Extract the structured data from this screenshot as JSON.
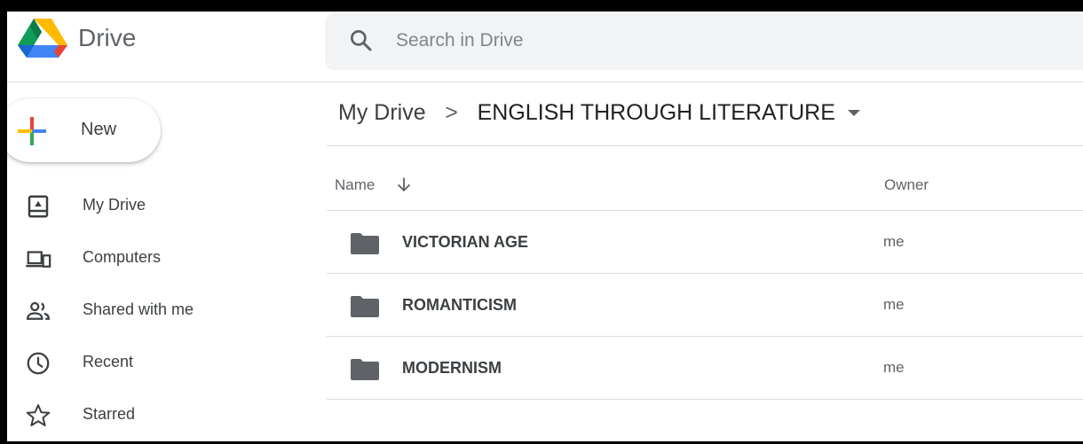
{
  "app": {
    "name": "Drive"
  },
  "search": {
    "placeholder": "Search in Drive"
  },
  "new_button": {
    "label": "New"
  },
  "sidebar": {
    "items": [
      {
        "label": "My Drive",
        "icon": "my-drive-icon"
      },
      {
        "label": "Computers",
        "icon": "computers-icon"
      },
      {
        "label": "Shared with me",
        "icon": "shared-icon"
      },
      {
        "label": "Recent",
        "icon": "clock-icon"
      },
      {
        "label": "Starred",
        "icon": "star-icon"
      }
    ]
  },
  "breadcrumb": {
    "root": "My Drive",
    "separator": ">",
    "current": "ENGLISH THROUGH LITERATURE"
  },
  "table": {
    "columns": {
      "name": "Name",
      "owner": "Owner"
    },
    "rows": [
      {
        "name": "VICTORIAN AGE",
        "owner": "me"
      },
      {
        "name": "ROMANTICISM",
        "owner": "me"
      },
      {
        "name": "MODERNISM",
        "owner": "me"
      }
    ]
  },
  "colors": {
    "folder": "#5f6368",
    "search_bg": "#f1f3f4",
    "divider": "#dadce0",
    "text": "#3c4043"
  }
}
